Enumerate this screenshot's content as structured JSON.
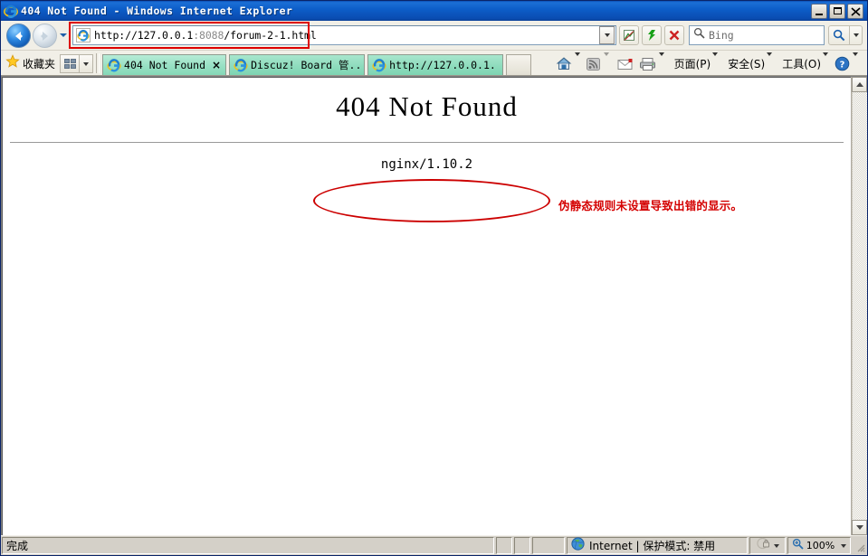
{
  "window": {
    "title": "404 Not Found - Windows Internet Explorer",
    "minimize_label": "Minimize",
    "maximize_label": "Maximize",
    "close_label": "Close"
  },
  "navigation": {
    "back_label": "Back",
    "forward_label": "Forward",
    "history_label": "Recent Pages",
    "address": {
      "protocol_host": "http://127.0.0.1",
      "port": ":8088",
      "path": "/forum-2-1.html",
      "full": "http://127.0.0.1:8088/forum-2-1.html"
    },
    "compat_label": "Compatibility View",
    "refresh_label": "Refresh",
    "stop_label": "Stop",
    "search": {
      "placeholder": "Bing",
      "go_label": "Search",
      "options_label": "Search Options"
    }
  },
  "favorites": {
    "label": "收藏夹",
    "grid_label": "Favorites Bar",
    "grid_dropdown_label": "Favorites Bar Menu"
  },
  "tabs": [
    {
      "label": "404 Not Found",
      "active": true,
      "close_label": "×"
    },
    {
      "label": "Discuz! Board 管...",
      "active": false
    },
    {
      "label": "http://127.0.0.1...",
      "active": false
    }
  ],
  "new_tab_label": "New Tab",
  "command_bar": [
    {
      "name": "home",
      "label": "主页",
      "has_caret": true
    },
    {
      "name": "feeds",
      "label": "源",
      "has_caret": true
    },
    {
      "name": "mail",
      "label": "邮件",
      "has_caret": false
    },
    {
      "name": "print",
      "label": "打印",
      "has_caret": true
    },
    {
      "name": "page",
      "label": "页面(P)",
      "has_caret": true
    },
    {
      "name": "safety",
      "label": "安全(S)",
      "has_caret": true
    },
    {
      "name": "tools",
      "label": "工具(O)",
      "has_caret": true
    },
    {
      "name": "help",
      "label": "帮助",
      "has_caret": true
    }
  ],
  "page": {
    "heading": "404 Not Found",
    "server": "nginx/1.10.2",
    "annotation_note": "伪静态规则未设置导致出错的显示。"
  },
  "status_bar": {
    "message": "完成",
    "zone": "Internet | 保护模式: 禁用",
    "zoom": "100%"
  },
  "colors": {
    "annotation_red": "#dd0000",
    "note_red": "#d40000",
    "title_blue": "#0d5ec9",
    "tab_green": "#8edcbd"
  }
}
